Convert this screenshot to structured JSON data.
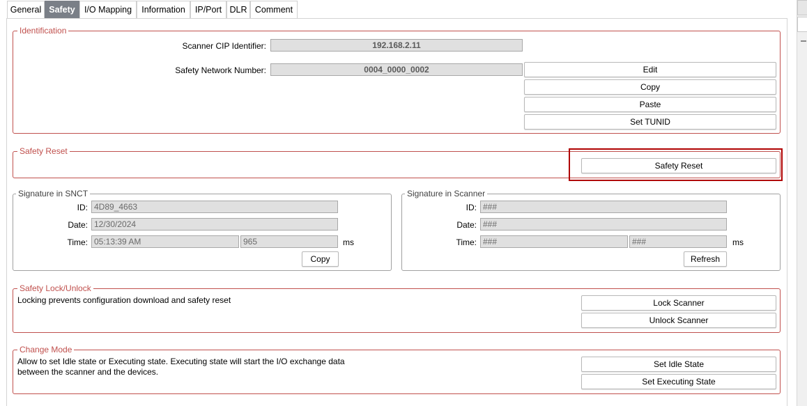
{
  "tabs": [
    "General",
    "Safety",
    "I/O Mapping",
    "Information",
    "IP/Port",
    "DLR",
    "Comment"
  ],
  "active_tab": "Safety",
  "identification": {
    "title": "Identification",
    "cip_label": "Scanner CIP Identifier:",
    "cip_value": "192.168.2.11",
    "snn_label": "Safety Network Number:",
    "snn_value": "0004_0000_0002",
    "buttons": {
      "edit": "Edit",
      "copy": "Copy",
      "paste": "Paste",
      "set_tunid": "Set TUNID"
    }
  },
  "safety_reset": {
    "title": "Safety Reset",
    "button": "Safety Reset",
    "highlight_color": "#b00000"
  },
  "signature_snct": {
    "title": "Signature in SNCT",
    "id_label": "ID:",
    "id_value": "4D89_4663",
    "date_label": "Date:",
    "date_value": "12/30/2024",
    "time_label": "Time:",
    "time_value": "05:13:39 AM",
    "ms_value": "965",
    "ms_unit": "ms",
    "copy_button": "Copy"
  },
  "signature_scanner": {
    "title": "Signature in Scanner",
    "id_label": "ID:",
    "id_value": "###",
    "date_label": "Date:",
    "date_value": "###",
    "time_label": "Time:",
    "time_value": "###",
    "ms_value": "###",
    "ms_unit": "ms",
    "refresh_button": "Refresh"
  },
  "lock": {
    "title": "Safety Lock/Unlock",
    "description": "Locking prevents configuration download and safety reset",
    "lock_button": "Lock Scanner",
    "unlock_button": "Unlock Scanner"
  },
  "change_mode": {
    "title": "Change Mode",
    "description_line1": "Allow to set Idle state or Executing state. Executing state will start the I/O exchange data",
    "description_line2": "between the scanner and the devices.",
    "idle_button": "Set Idle State",
    "exec_button": "Set Executing State"
  },
  "colors": {
    "accent_border": "#c0504d",
    "active_tab": "#7a7f87"
  }
}
